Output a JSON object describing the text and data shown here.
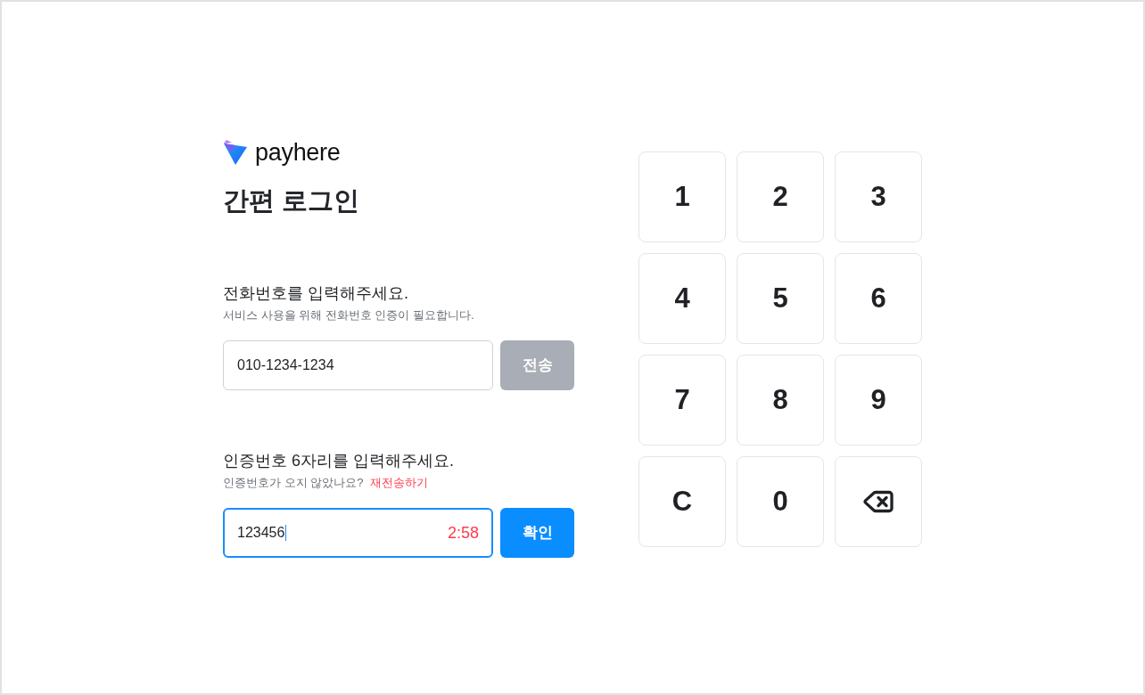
{
  "logo": {
    "text": "payhere"
  },
  "title": "간편 로그인",
  "phone_section": {
    "label": "전화번호를 입력해주세요.",
    "hint": "서비스 사용을 위해 전화번호 인증이 필요합니다.",
    "field": {
      "value": "010-1234-1234",
      "focused": false
    },
    "button": {
      "label": "전송",
      "disabled": true
    }
  },
  "code_section": {
    "label": "인증번호 6자리를 입력해주세요.",
    "hint": "인증번호가 오지 않았나요?",
    "resend_link": "재전송하기",
    "field": {
      "value": "123456",
      "focused": true,
      "timer": "2:58"
    },
    "button": {
      "label": "확인",
      "disabled": false
    }
  },
  "keypad": [
    {
      "kind": "digit",
      "label": "1"
    },
    {
      "kind": "digit",
      "label": "2"
    },
    {
      "kind": "digit",
      "label": "3"
    },
    {
      "kind": "digit",
      "label": "4"
    },
    {
      "kind": "digit",
      "label": "5"
    },
    {
      "kind": "digit",
      "label": "6"
    },
    {
      "kind": "digit",
      "label": "7"
    },
    {
      "kind": "digit",
      "label": "8"
    },
    {
      "kind": "digit",
      "label": "9"
    },
    {
      "kind": "clear",
      "label": "C"
    },
    {
      "kind": "digit",
      "label": "0"
    },
    {
      "kind": "backspace"
    }
  ]
}
